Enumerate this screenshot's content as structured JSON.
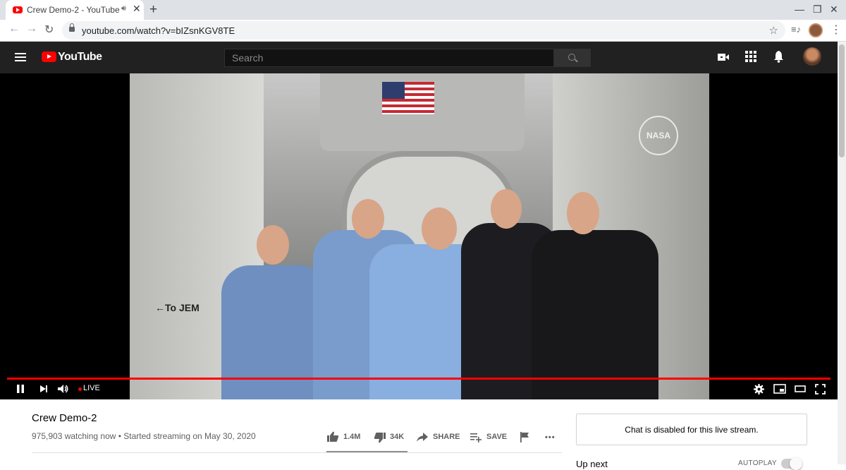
{
  "browser": {
    "tab_title": "Crew Demo-2 - YouTube",
    "tab_close": "✕",
    "new_tab": "+",
    "url": "youtube.com/watch?v=bIZsnKGV8TE",
    "window_min": "—",
    "window_restore": "❐",
    "window_close": "✕"
  },
  "youtube": {
    "logo_text": "YouTube",
    "search_placeholder": "Search"
  },
  "video_frame": {
    "sign_text": "←To JEM",
    "patch_text": "NASA"
  },
  "player": {
    "live_label": "LIVE",
    "progress_fraction": 1.0
  },
  "video": {
    "title": "Crew Demo-2",
    "meta": "975,903 watching now • Started streaming on May 30, 2020",
    "likes": "1.4M",
    "dislikes": "34K",
    "share_label": "SHARE",
    "save_label": "SAVE",
    "more_label": "•••"
  },
  "sidebar": {
    "chat_disabled": "Chat is disabled for this live stream.",
    "up_next": "Up next",
    "autoplay": "AUTOPLAY"
  },
  "colors": {
    "accent": "#ff0000",
    "masthead": "#212121"
  }
}
